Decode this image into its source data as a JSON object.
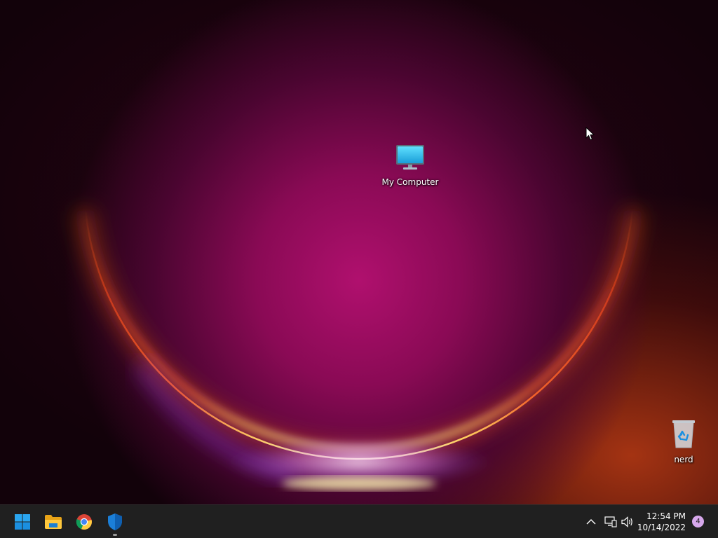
{
  "desktop": {
    "icons": [
      {
        "label": "My Computer",
        "icon": "monitor-icon"
      },
      {
        "label": "nerd",
        "icon": "recycle-bin-icon"
      }
    ]
  },
  "taskbar": {
    "pinned": [
      {
        "name": "Start",
        "icon": "windows-logo-icon"
      },
      {
        "name": "File Explorer",
        "icon": "folder-icon"
      },
      {
        "name": "Google Chrome",
        "icon": "chrome-icon"
      },
      {
        "name": "Windows Security",
        "icon": "shield-icon",
        "running": true
      }
    ],
    "tray": {
      "time": "12:54 PM",
      "date": "10/14/2022",
      "notification_count": "4"
    }
  },
  "colors": {
    "taskbar": "#202020",
    "accent_blue": "#0a7fd6",
    "notification_badge": "#d7a8ec"
  }
}
